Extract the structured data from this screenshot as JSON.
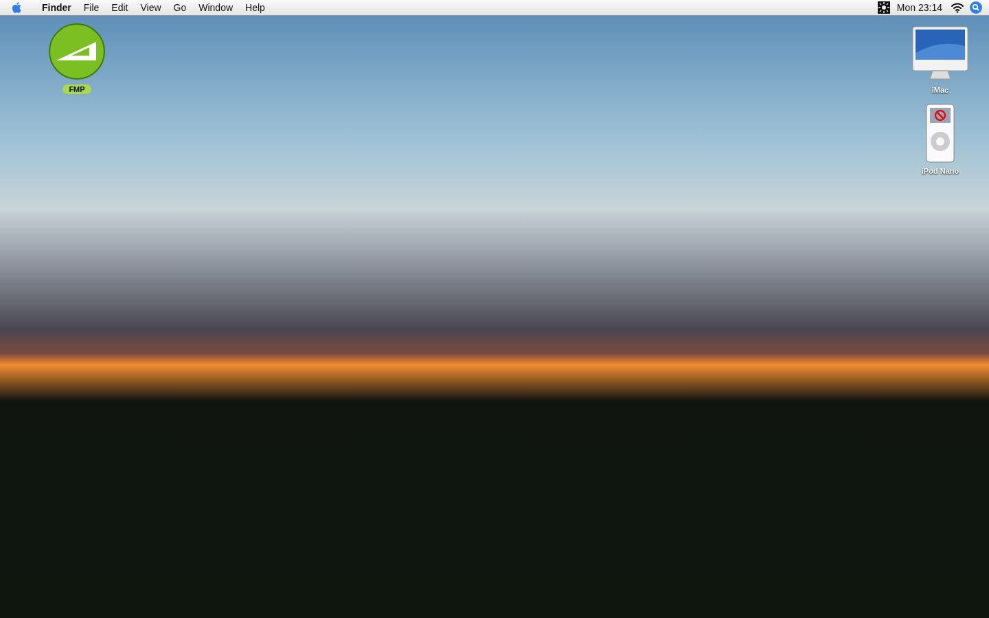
{
  "menu_bar": {
    "app_name": "Finder",
    "menus": [
      "File",
      "Edit",
      "View",
      "Go",
      "Window",
      "Help"
    ],
    "clock": "Mon 23:14"
  },
  "desktop": {
    "left_icons": [
      {
        "kind": "app",
        "label": "FMP",
        "color": "#a8d84c"
      }
    ],
    "right_icons": [
      {
        "kind": "computer",
        "label": "iMac"
      },
      {
        "kind": "ipod",
        "label": "iPod Nano"
      }
    ]
  }
}
